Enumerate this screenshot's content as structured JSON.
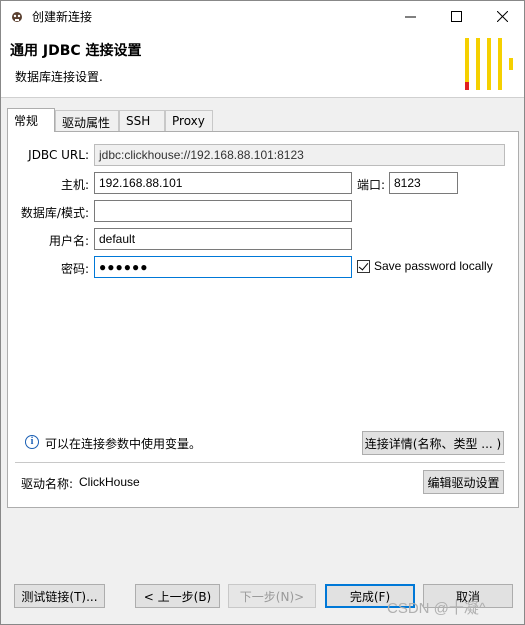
{
  "window": {
    "title": "创建新连接",
    "controls": {
      "minimize": "—",
      "maximize": "☐",
      "close": "✕"
    }
  },
  "header": {
    "title": "通用 JDBC 连接设置",
    "subtitle": "数据库连接设置.",
    "logo_colors": {
      "bars": "#f5d000",
      "accent": "#e02020"
    }
  },
  "tabs": [
    "常规",
    "驱动属性",
    "SSH",
    "Proxy"
  ],
  "form": {
    "jdbc_url_label": "JDBC URL:",
    "jdbc_url_value": "jdbc:clickhouse://192.168.88.101:8123",
    "host_label": "主机:",
    "host_value": "192.168.88.101",
    "port_label": "端口:",
    "port_value": "8123",
    "db_label": "数据库/模式:",
    "db_value": "",
    "user_label": "用户名:",
    "user_value": "default",
    "password_label": "密码:",
    "password_value": "●●●●●●",
    "save_password_label": "Save password locally",
    "save_password_checked": true
  },
  "info": {
    "text": "可以在连接参数中使用变量。",
    "details_button": "连接详情(名称、类型 ... )"
  },
  "driver": {
    "label": "驱动名称:",
    "value": "ClickHouse",
    "edit_button": "编辑驱动设置"
  },
  "footer": {
    "test_button": "测试链接(T)...",
    "back_button": "< 上一步(B)",
    "next_button": "下一步(N)>",
    "finish_button": "完成(F)",
    "cancel_button": "取消"
  },
  "watermark": "CSDN @十凝^"
}
